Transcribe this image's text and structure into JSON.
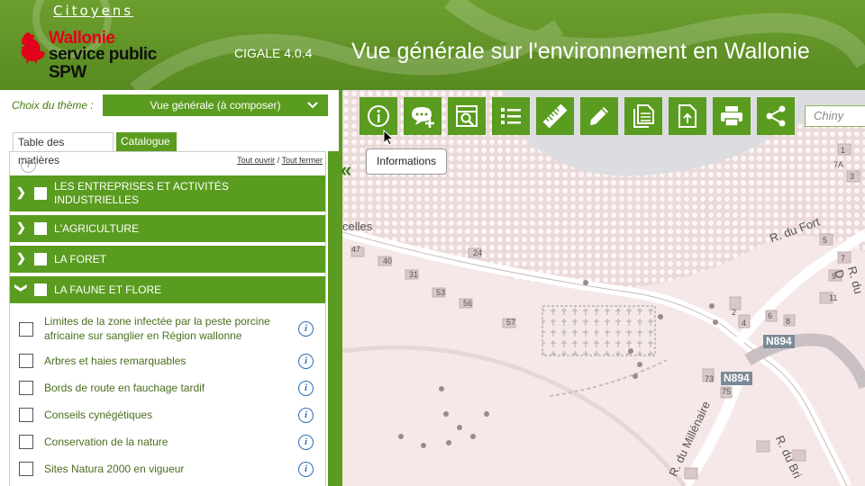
{
  "header": {
    "citoyens": "Citoyens",
    "logo_line1": "Wallonie",
    "logo_line2": "service public",
    "logo_line3": "SPW",
    "version": "CIGALE 4.0.4",
    "title": "Vue générale sur l'environnement en Wallonie"
  },
  "panel": {
    "theme_label": "Choix du thème :",
    "theme_value": "Vue générale (à composer)",
    "tabs": [
      "Table des matières",
      "Catalogue"
    ],
    "open_all": "Tout ouvrir",
    "separator": " / ",
    "close_all": "Tout fermer",
    "help": "?",
    "categories": [
      {
        "label": "LES ENTREPRISES ET ACTIVITÉS INDUSTRIELLES",
        "expanded": false
      },
      {
        "label": "L'AGRICULTURE",
        "expanded": false
      },
      {
        "label": "LA FORET",
        "expanded": false
      },
      {
        "label": "LA FAUNE ET FLORE",
        "expanded": true
      }
    ],
    "layers": [
      "Limites de la zone infectée par la peste porcine africaine sur sanglier en Région wallonne",
      "Arbres et haies remarquables",
      "Bords de route en fauchage tardif",
      "Conseils cynégétiques",
      "Conservation de la nature",
      "Sites Natura 2000 en vigueur"
    ]
  },
  "toolbar": {
    "buttons": [
      "info-icon",
      "comment-add-icon",
      "search-doc-icon",
      "list-icon",
      "ruler-icon",
      "pencil-icon",
      "copy-icon",
      "upload-icon",
      "print-icon",
      "share-icon"
    ],
    "search_value": "Chiny",
    "tooltip": "Informations"
  },
  "map": {
    "labels": {
      "celles": "celles",
      "rue_fort": "R. du Fort",
      "rue_d": "R. du D",
      "rue_millenaire": "R. du Millénaire",
      "rue_bri": "R. du Bri",
      "n894_a": "N894",
      "n894_b": "N894"
    },
    "house_numbers": [
      "47",
      "40",
      "24",
      "31",
      "53",
      "56",
      "57",
      "73",
      "75",
      "2",
      "4",
      "6",
      "8",
      "11",
      "9",
      "7",
      "5",
      "3",
      "1",
      "7A"
    ]
  },
  "colors": {
    "header_green": "#5f9126",
    "button_green": "#5a9c1f",
    "map_bg": "#f6e8e8",
    "info_blue": "#2a6db5"
  }
}
